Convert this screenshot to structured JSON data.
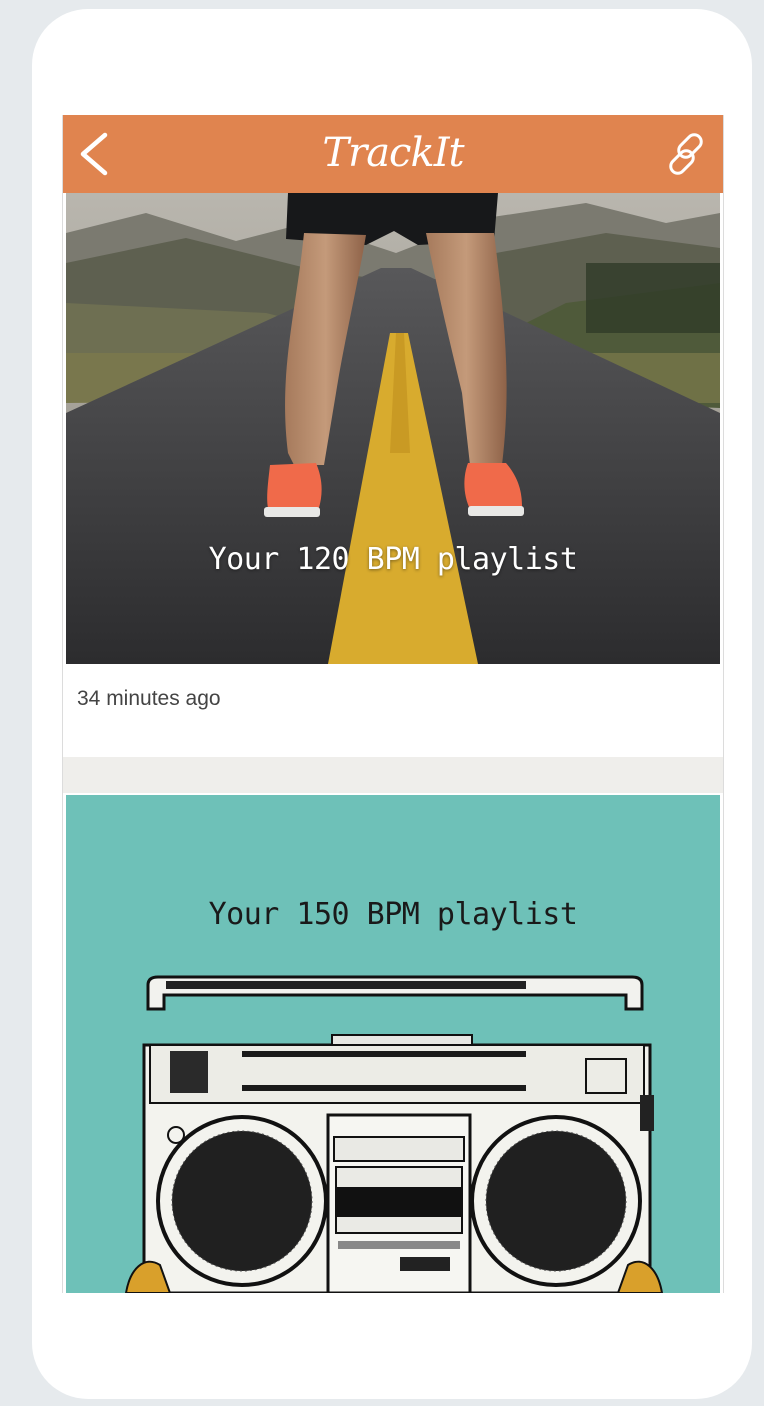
{
  "app": {
    "title": "TrackIt",
    "accent_color": "#e0844f",
    "nav_back_icon": "chevron-left-icon",
    "share_icon": "link-icon"
  },
  "feed": [
    {
      "title": "Your 120 BPM playlist",
      "timestamp": "34 minutes ago",
      "image": "runner-on-road"
    },
    {
      "title": "Your 150 BPM playlist",
      "image": "boombox-on-teal"
    }
  ]
}
